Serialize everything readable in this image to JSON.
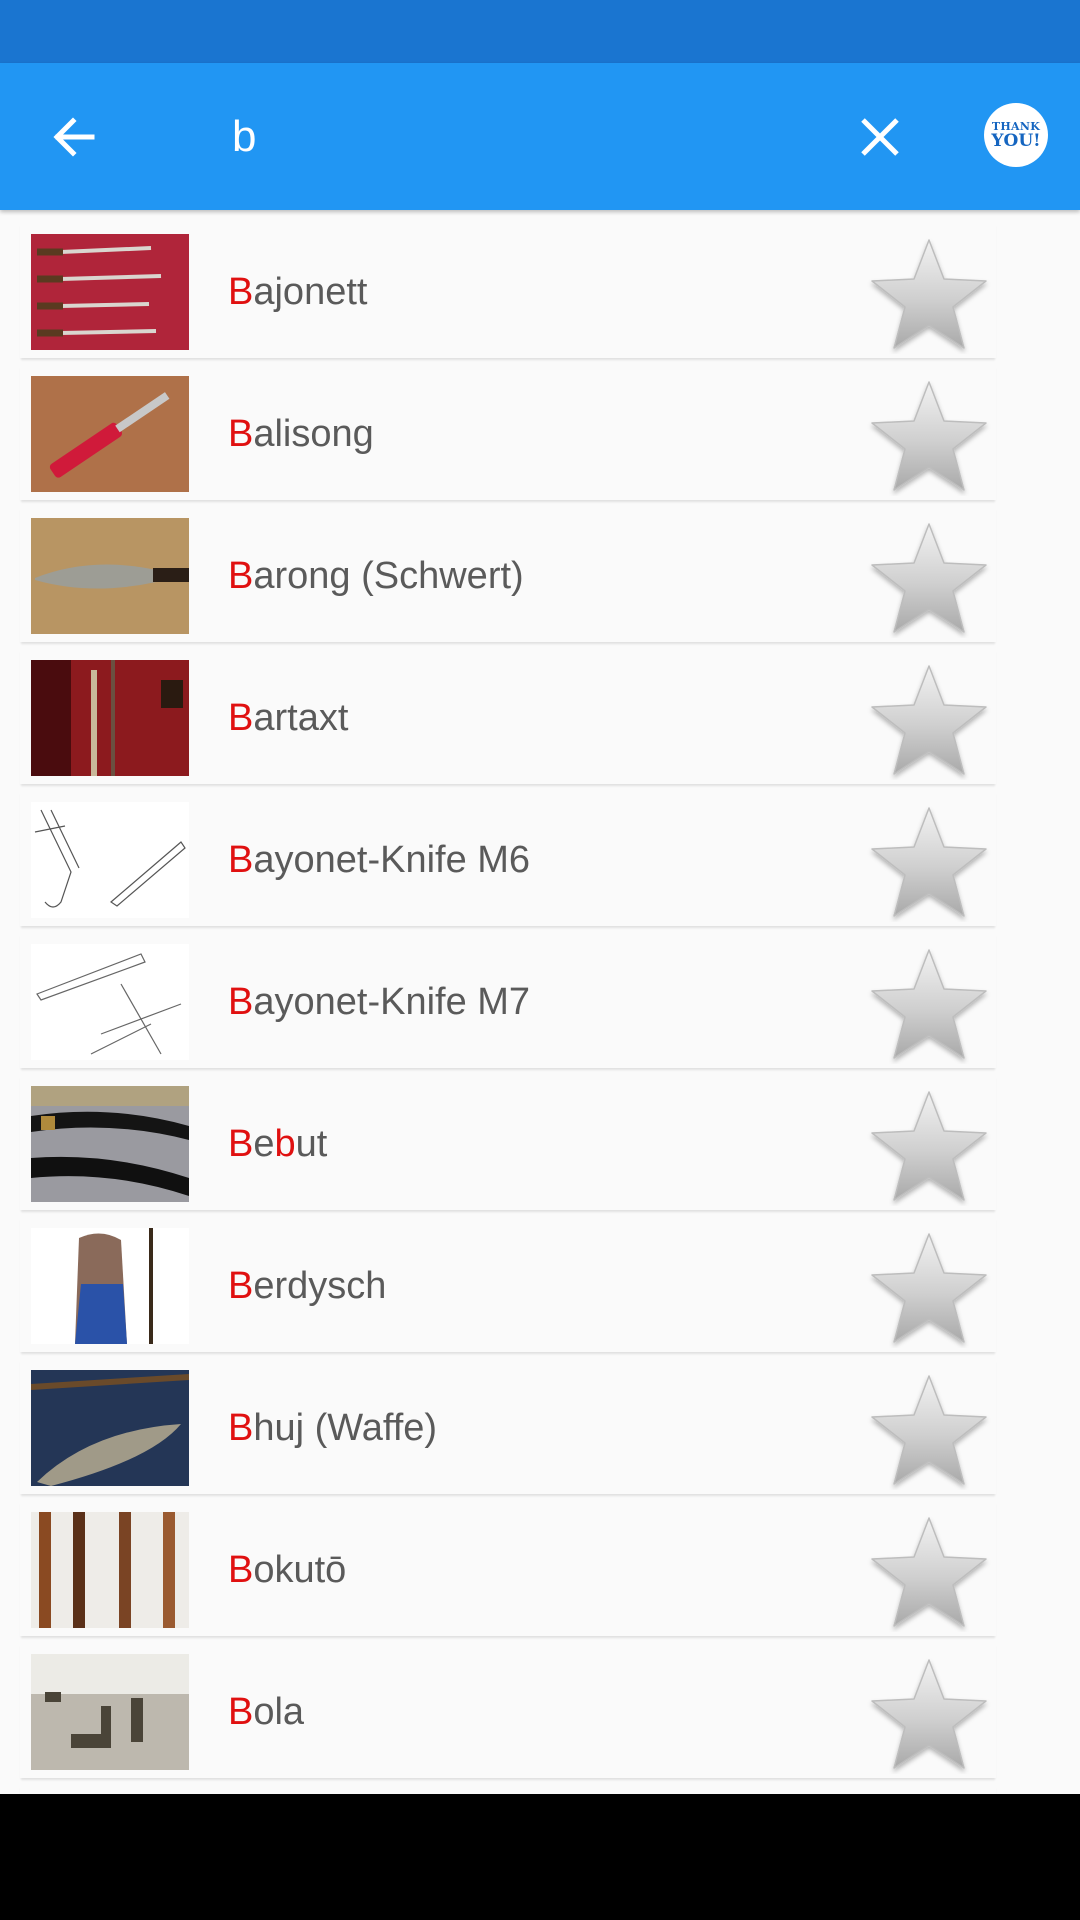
{
  "search": {
    "query": "b"
  },
  "header": {
    "badge_line1": "THANK",
    "badge_line2": "YOU!"
  },
  "items": [
    {
      "hl": "B",
      "rest": "ajonett"
    },
    {
      "hl": "B",
      "rest": "alisong"
    },
    {
      "hl": "B",
      "rest": "arong (Schwert)"
    },
    {
      "hl": "B",
      "rest": "artaxt"
    },
    {
      "hl": "B",
      "rest": "ayonet-Knife M6"
    },
    {
      "hl": "B",
      "rest": "ayonet-Knife M7"
    },
    {
      "hl": "B",
      "mid": "e",
      "hl2": "b",
      "rest": "ut"
    },
    {
      "hl": "B",
      "rest": "erdysch"
    },
    {
      "hl": "B",
      "rest": "huj (Waffe)"
    },
    {
      "hl": "B",
      "rest": "okutō"
    },
    {
      "hl": "B",
      "rest": "ola"
    }
  ],
  "colors": {
    "statusbar": "#1a75d0",
    "appbar": "#2196f3",
    "highlight": "#e01010",
    "label": "#5a5a5a"
  }
}
